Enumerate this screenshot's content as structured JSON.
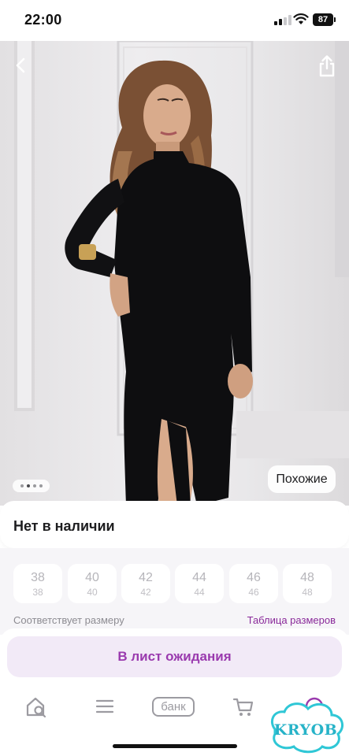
{
  "status_bar": {
    "time": "22:00",
    "battery": "87"
  },
  "product_photo": {
    "page_dots": 4,
    "active_dot": 2,
    "similar_label": "Похожие"
  },
  "availability": {
    "title": "Нет в наличии"
  },
  "sizes": {
    "items": [
      {
        "main": "38",
        "sub": "38"
      },
      {
        "main": "40",
        "sub": "40"
      },
      {
        "main": "42",
        "sub": "42"
      },
      {
        "main": "44",
        "sub": "44"
      },
      {
        "main": "46",
        "sub": "46"
      },
      {
        "main": "48",
        "sub": "48"
      }
    ],
    "fit_text": "Соответствует размеру",
    "size_table_link": "Таблица размеров"
  },
  "waitlist": {
    "button_label": "В лист ожидания"
  },
  "tab_bar": {
    "items": [
      "search-home-icon",
      "menu-icon",
      "bank-badge",
      "cart-icon",
      "profile-icon"
    ],
    "bank_label": "банк"
  },
  "watermark": {
    "text": "KRYOB"
  },
  "colors": {
    "accent": "#9a3aae",
    "link": "#8a2a9a",
    "button_bg": "#f2eaf7",
    "background": "#f6f5f8"
  }
}
